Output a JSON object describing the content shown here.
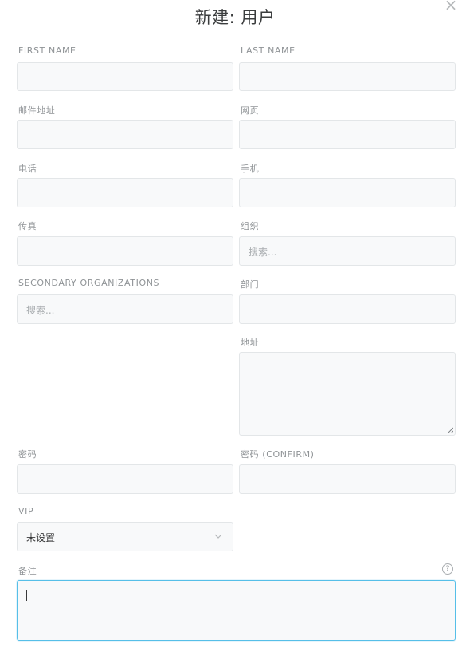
{
  "dialog": {
    "title": "新建: 用户",
    "close_icon": "close-icon"
  },
  "fields": {
    "first_name": {
      "label": "FIRST NAME",
      "value": ""
    },
    "last_name": {
      "label": "LAST NAME",
      "value": ""
    },
    "email": {
      "label": "邮件地址",
      "value": ""
    },
    "web": {
      "label": "网页",
      "value": ""
    },
    "phone": {
      "label": "电话",
      "value": ""
    },
    "mobile": {
      "label": "手机",
      "value": ""
    },
    "fax": {
      "label": "传真",
      "value": ""
    },
    "organization": {
      "label": "组织",
      "placeholder": "搜索..."
    },
    "secondary_organizations": {
      "label": "SECONDARY ORGANIZATIONS",
      "placeholder": "搜索..."
    },
    "department": {
      "label": "部门",
      "value": ""
    },
    "address": {
      "label": "地址",
      "value": ""
    },
    "password": {
      "label": "密码",
      "value": ""
    },
    "password_confirm": {
      "label": "密码 (CONFIRM)",
      "value": ""
    },
    "vip": {
      "label": "VIP",
      "selected": "未设置",
      "icon": "chevron-down-icon"
    },
    "note": {
      "label": "备注",
      "value": "",
      "help_icon": "question-icon"
    }
  },
  "colors": {
    "field_bg": "#f8f9fa",
    "field_border": "#e3e6e8",
    "focus_border": "#56bfe8",
    "label": "#8f9396"
  }
}
